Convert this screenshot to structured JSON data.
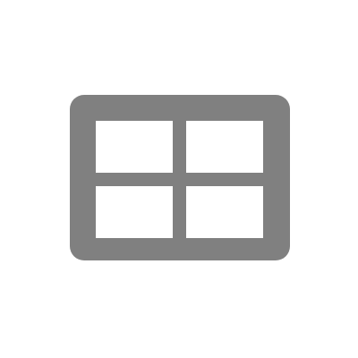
{
  "icon": {
    "name": "grid-view-icon",
    "color": "#808080",
    "background": "#ffffff"
  }
}
